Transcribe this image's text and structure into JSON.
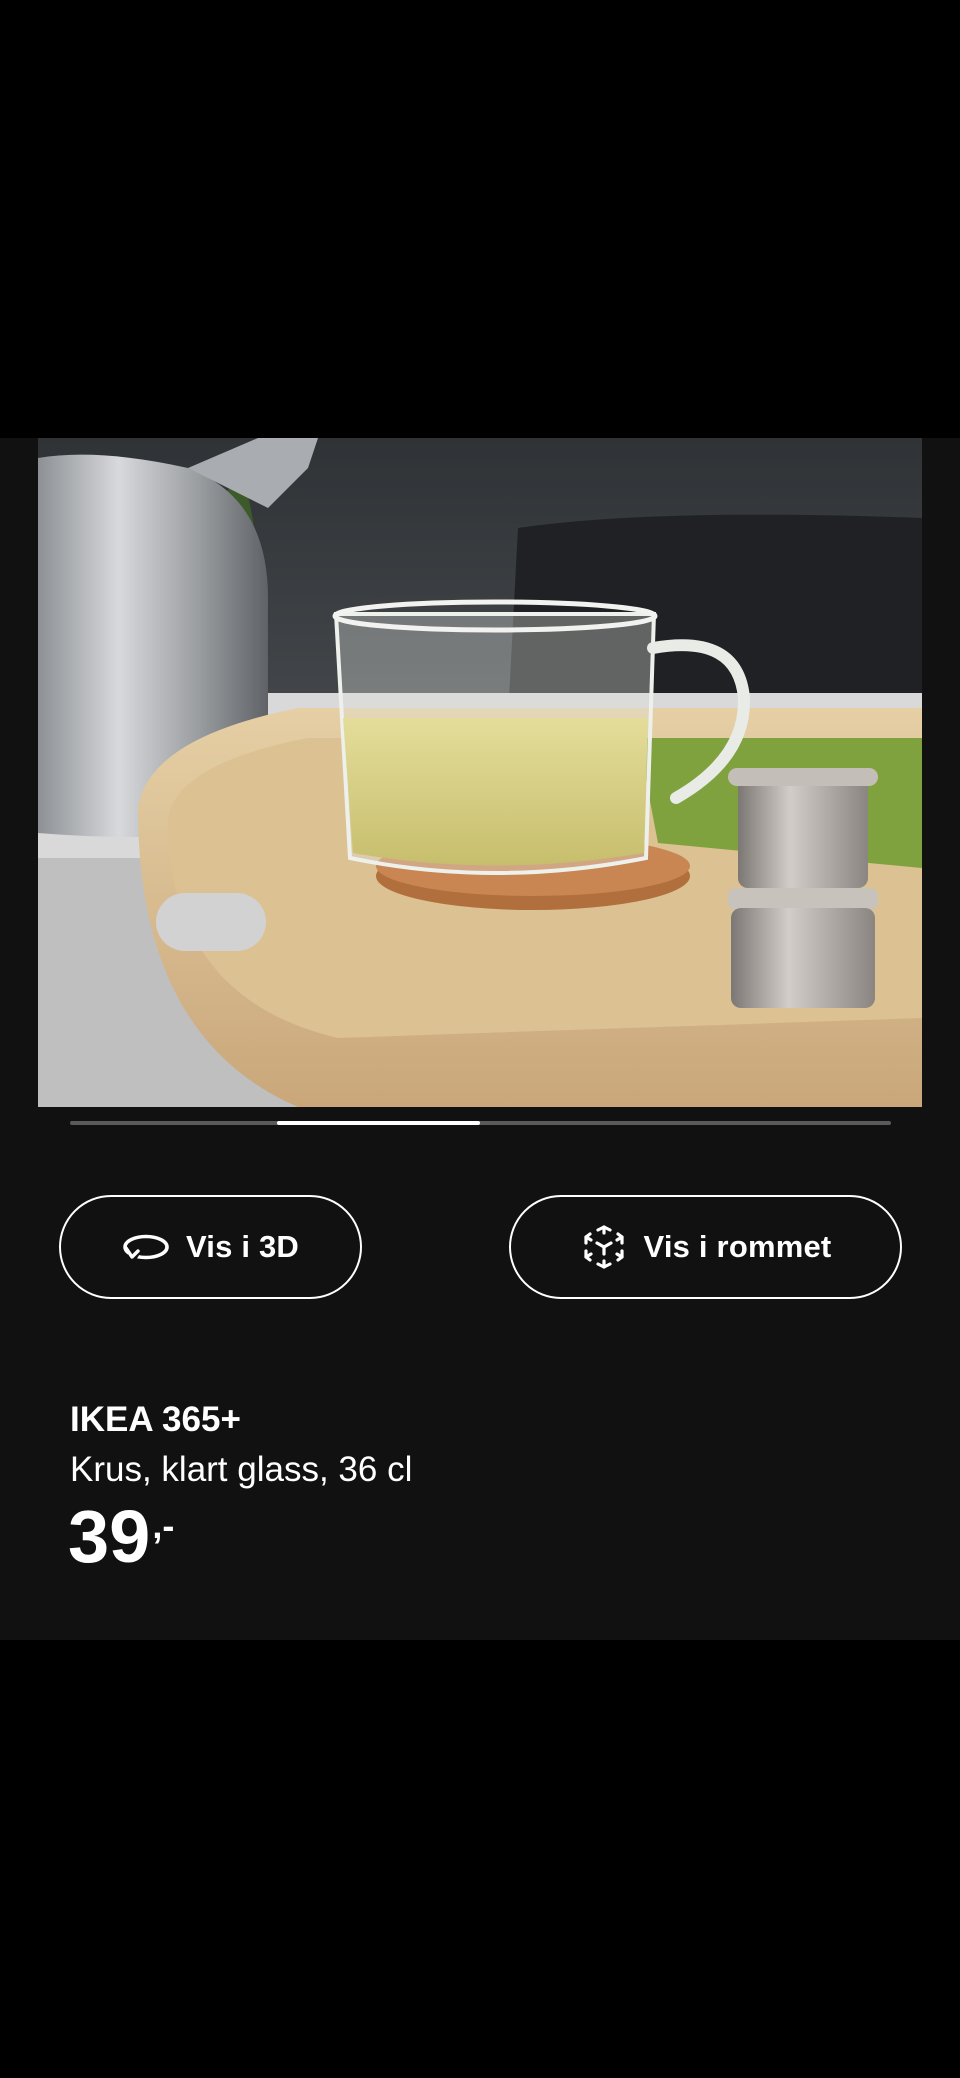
{
  "gallery": {
    "image_alt": "IKEA 365+ glass mug with tea on a wooden tray",
    "current_slide": 2,
    "slide_count": 4
  },
  "actions": {
    "view_3d_label": "Vis i 3D",
    "view_in_room_label": "Vis i rommet"
  },
  "product": {
    "brand": "IKEA 365+",
    "description": "Krus, klart glass, 36 cl",
    "price": "39",
    "price_suffix": ",-"
  },
  "icons": {
    "view_3d": "rotate-3d-icon",
    "view_in_room": "ar-cube-icon"
  },
  "colors": {
    "background": "#000000",
    "panel": "#111111",
    "text": "#ffffff",
    "indicator_track": "#5a5a5a",
    "indicator_active": "#ffffff"
  }
}
